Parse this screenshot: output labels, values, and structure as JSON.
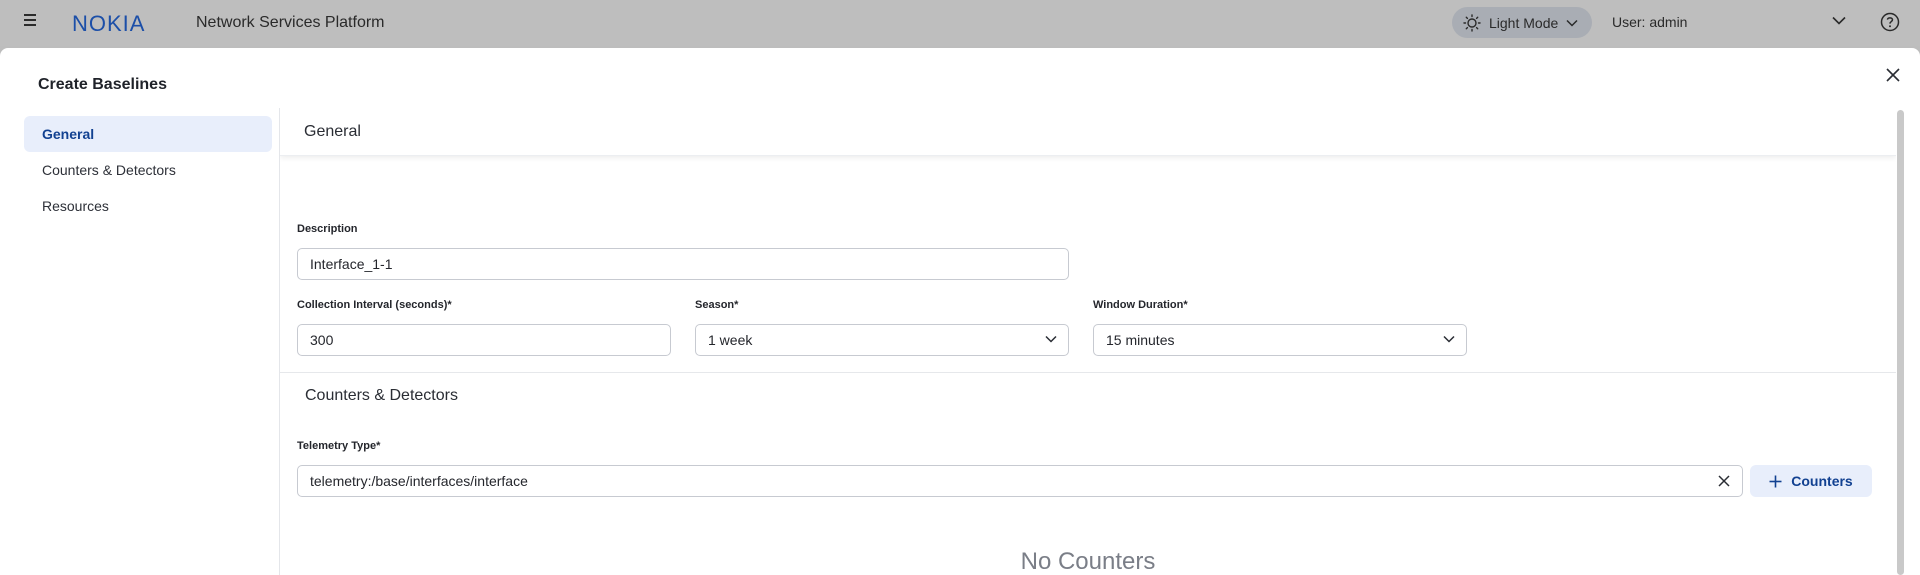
{
  "topbar": {
    "logo_text": "NOKIA",
    "app_title": "Network Services Platform",
    "mode_label": "Light Mode",
    "user_label": "User: admin"
  },
  "modal": {
    "title": "Create Baselines"
  },
  "nav": {
    "items": [
      {
        "label": "General",
        "active": true
      },
      {
        "label": "Counters & Detectors",
        "active": false
      },
      {
        "label": "Resources",
        "active": false
      }
    ]
  },
  "general": {
    "heading": "General",
    "description": {
      "label": "Description",
      "value": "Interface_1-1"
    },
    "collection_interval": {
      "label": "Collection Interval (seconds)*",
      "value": "300"
    },
    "season": {
      "label": "Season*",
      "value": "1 week"
    },
    "window_duration": {
      "label": "Window Duration*",
      "value": "15 minutes"
    }
  },
  "counters": {
    "heading": "Counters & Detectors",
    "telemetry_type": {
      "label": "Telemetry Type*",
      "value": "telemetry:/base/interfaces/interface"
    },
    "add_button_label": "Counters",
    "empty_text": "No Counters"
  },
  "colors": {
    "brand": "#124191",
    "active_bg": "#e8eefb"
  }
}
